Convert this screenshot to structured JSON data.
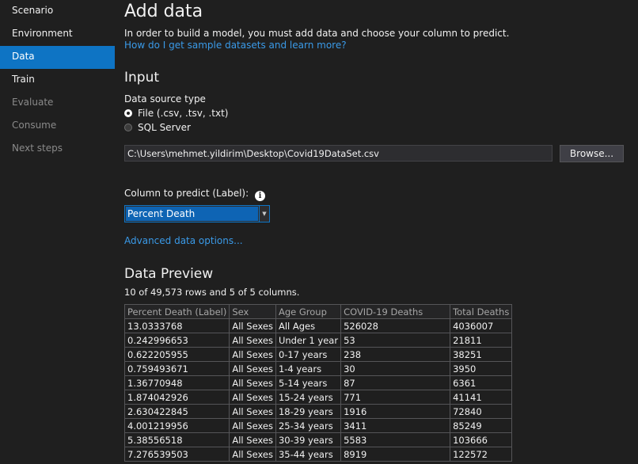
{
  "sidebar": {
    "items": [
      {
        "label": "Scenario",
        "state": "normal"
      },
      {
        "label": "Environment",
        "state": "normal"
      },
      {
        "label": "Data",
        "state": "active"
      },
      {
        "label": "Train",
        "state": "normal"
      },
      {
        "label": "Evaluate",
        "state": "disabled"
      },
      {
        "label": "Consume",
        "state": "disabled"
      },
      {
        "label": "Next steps",
        "state": "disabled"
      }
    ]
  },
  "header": {
    "title": "Add data",
    "description": "In order to build a model, you must add data and choose your column to predict.",
    "help_link": "How do I get sample datasets and learn more?"
  },
  "input": {
    "section_title": "Input",
    "source_label": "Data source type",
    "options": [
      {
        "label": "File (.csv, .tsv, .txt)",
        "checked": true
      },
      {
        "label": "SQL Server",
        "checked": false
      }
    ],
    "file_path": "C:\\Users\\mehmet.yildirim\\Desktop\\Covid19DataSet.csv",
    "browse_label": "Browse..."
  },
  "predict": {
    "label": "Column to predict (Label):",
    "info_icon": "i",
    "selected": "Percent Death",
    "advanced_link": "Advanced data options..."
  },
  "preview": {
    "section_title": "Data Preview",
    "rows_info": "10 of 49,573 rows and 5 of 5 columns.",
    "columns": [
      "Percent Death (Label)",
      "Sex",
      "Age Group",
      "COVID-19 Deaths",
      "Total Deaths"
    ],
    "rows": [
      [
        "13.0333768",
        "All Sexes",
        "All Ages",
        "526028",
        "4036007"
      ],
      [
        "0.242996653",
        "All Sexes",
        "Under 1 year",
        "53",
        "21811"
      ],
      [
        "0.622205955",
        "All Sexes",
        "0-17 years",
        "238",
        "38251"
      ],
      [
        "0.759493671",
        "All Sexes",
        "1-4 years",
        "30",
        "3950"
      ],
      [
        "1.36770948",
        "All Sexes",
        "5-14 years",
        "87",
        "6361"
      ],
      [
        "1.874042926",
        "All Sexes",
        "15-24 years",
        "771",
        "41141"
      ],
      [
        "2.630422845",
        "All Sexes",
        "18-29 years",
        "1916",
        "72840"
      ],
      [
        "4.001219956",
        "All Sexes",
        "25-34 years",
        "3411",
        "85249"
      ],
      [
        "5.38556518",
        "All Sexes",
        "30-39 years",
        "5583",
        "103666"
      ],
      [
        "7.276539503",
        "All Sexes",
        "35-44 years",
        "8919",
        "122572"
      ]
    ]
  },
  "colors": {
    "accent": "#0e74c4",
    "link": "#3a9ae8",
    "background": "#1f1f1f"
  }
}
